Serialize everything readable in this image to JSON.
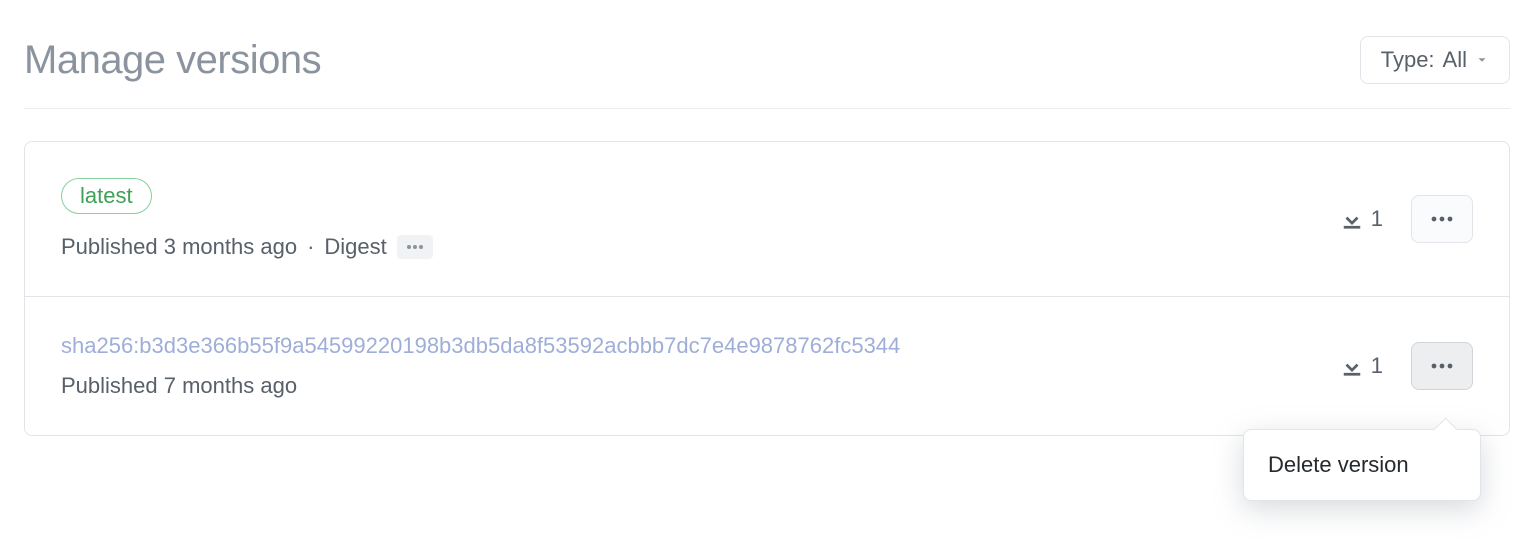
{
  "header": {
    "title": "Manage versions",
    "filter_label": "Type:",
    "filter_value": "All"
  },
  "versions": [
    {
      "tag": "latest",
      "published_text": "Published 3 months ago",
      "separator": "·",
      "digest_label": "Digest",
      "download_count": "1"
    },
    {
      "sha_link": "sha256:b3d3e366b55f9a54599220198b3db5da8f53592acbbb7dc7e4e9878762fc5344",
      "published_text": "Published 7 months ago",
      "download_count": "1"
    }
  ],
  "dropdown": {
    "delete_label": "Delete version"
  }
}
